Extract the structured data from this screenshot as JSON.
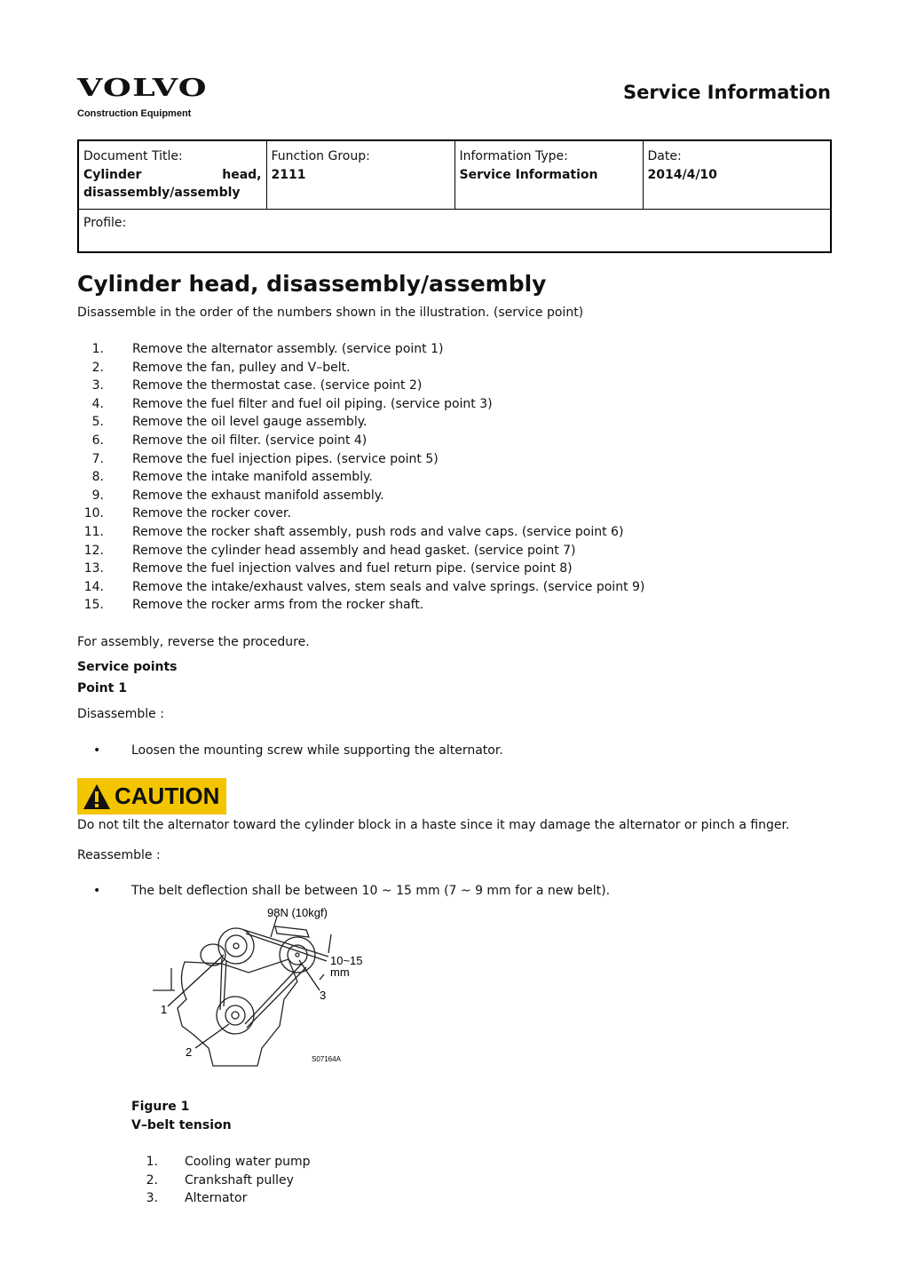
{
  "header": {
    "logo": "VOLVO",
    "logo_sub": "Construction Equipment",
    "service_title": "Service Information"
  },
  "doc_table": {
    "doc_title_label": "Document Title:",
    "doc_title_line1a": "Cylinder",
    "doc_title_line1b": "head,",
    "doc_title_line2": "disassembly/assembly",
    "function_group_label": "Function Group:",
    "function_group": "2111",
    "info_type_label": "Information Type:",
    "info_type": "Service Information",
    "date_label": "Date:",
    "date": "2014/4/10",
    "profile_label": "Profile:"
  },
  "main": {
    "title": "Cylinder head, disassembly/assembly",
    "intro": "Disassemble in the order of the numbers shown in the illustration. (service point)",
    "steps": [
      {
        "n": "1.",
        "text": "Remove the alternator assembly. (service point 1)"
      },
      {
        "n": "2.",
        "text": "Remove the fan, pulley and V–belt."
      },
      {
        "n": "3.",
        "text": "Remove the thermostat case. (service point 2)"
      },
      {
        "n": "4.",
        "text": "Remove the fuel filter and fuel oil piping. (service point 3)"
      },
      {
        "n": "5.",
        "text": "Remove the oil level gauge assembly."
      },
      {
        "n": "6.",
        "text": "Remove the oil filter. (service point 4)"
      },
      {
        "n": "7.",
        "text": "Remove the fuel injection pipes. (service point 5)"
      },
      {
        "n": "8.",
        "text": "Remove the intake manifold assembly."
      },
      {
        "n": "9.",
        "text": "Remove the exhaust manifold assembly."
      },
      {
        "n": "10.",
        "text": "Remove the rocker cover."
      },
      {
        "n": "11.",
        "text": "Remove the rocker shaft assembly, push rods and valve caps. (service point 6)"
      },
      {
        "n": "12.",
        "text": "Remove the cylinder head assembly and head gasket. (service point 7)"
      },
      {
        "n": "13.",
        "text": "Remove the fuel injection valves and fuel return pipe. (service point 8)"
      },
      {
        "n": "14.",
        "text": "Remove the intake/exhaust valves, stem seals and valve springs. (service point 9)"
      },
      {
        "n": "15.",
        "text": "Remove the rocker arms from the rocker shaft."
      }
    ],
    "assembly_note": "For assembly, reverse the procedure.",
    "service_points": "Service points",
    "point1": "Point 1",
    "disassemble": "Disassemble :",
    "disassemble_bullet": "Loosen the mounting screw while supporting the alternator.",
    "caution_label": "CAUTION",
    "caution_text": "Do not tilt the alternator toward the cylinder block in a haste since it may damage the alternator or pinch a finger.",
    "reassemble": "Reassemble :",
    "reassemble_bullet": "The belt deflection shall be between 10 ~ 15 mm (7 ~ 9 mm for a new belt).",
    "bullet_char": "•"
  },
  "figure": {
    "force_label": "98N (10kgf)",
    "deflection_label_1": "10~15",
    "deflection_label_2": "mm",
    "callout_1": "1",
    "callout_2": "2",
    "callout_3": "3",
    "code": "S07164A",
    "caption_title": "Figure 1",
    "caption_sub": "V–belt tension",
    "legend": [
      {
        "n": "1.",
        "text": "Cooling water pump"
      },
      {
        "n": "2.",
        "text": "Crankshaft pulley"
      },
      {
        "n": "3.",
        "text": "Alternator"
      }
    ]
  },
  "colors": {
    "caution_bg": "#f2c500"
  }
}
